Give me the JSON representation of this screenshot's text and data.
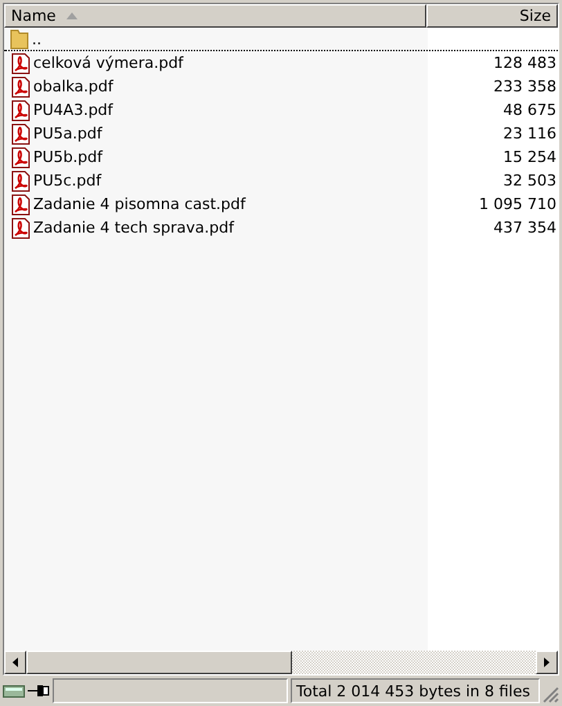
{
  "columns": [
    {
      "label": "Name",
      "sorted": true
    },
    {
      "label": "Size",
      "sorted": false
    }
  ],
  "rows": [
    {
      "kind": "parent",
      "name": "..",
      "size": "",
      "focused": true
    },
    {
      "kind": "pdf",
      "name": "celková výmera.pdf",
      "size": "128 483",
      "focused": false
    },
    {
      "kind": "pdf",
      "name": "obalka.pdf",
      "size": "233 358",
      "focused": false
    },
    {
      "kind": "pdf",
      "name": "PU4A3.pdf",
      "size": "48 675",
      "focused": false
    },
    {
      "kind": "pdf",
      "name": "PU5a.pdf",
      "size": "23 116",
      "focused": false
    },
    {
      "kind": "pdf",
      "name": "PU5b.pdf",
      "size": "15 254",
      "focused": false
    },
    {
      "kind": "pdf",
      "name": "PU5c.pdf",
      "size": "32 503",
      "focused": false
    },
    {
      "kind": "pdf",
      "name": "Zadanie 4 pisomna cast.pdf",
      "size": "1 095 710",
      "focused": false
    },
    {
      "kind": "pdf",
      "name": "Zadanie 4 tech sprava.pdf",
      "size": "437 354",
      "focused": false
    }
  ],
  "status_bar": {
    "total": "Total 2 014 453 bytes in 8 files"
  }
}
